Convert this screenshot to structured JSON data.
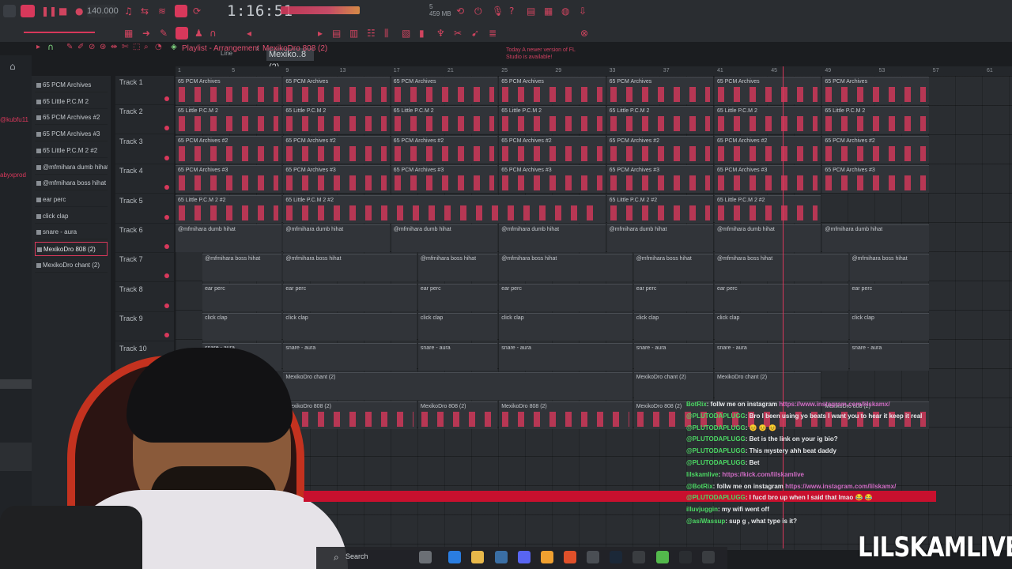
{
  "toolbar": {
    "tempo": "140.000",
    "song_time": "1:16:51",
    "memory": "459 MB",
    "cpu_line": "5",
    "line_mode": "Line",
    "mixer_track": "Mexiko..8 (2)",
    "update_notice": "Today  A newer version of FL Studio is available!",
    "accent_color": "#d8385b"
  },
  "breadcrumb": {
    "title": "Playlist - Arrangement",
    "separator": "›",
    "pattern": "MexikoDro 808 (2)"
  },
  "left_tags": [
    "@kubfu11",
    "abyxprod"
  ],
  "channel_picker": [
    {
      "label": "65 PCM Archives",
      "selected": false
    },
    {
      "label": "65 Little P.C.M 2",
      "selected": false
    },
    {
      "label": "65 PCM Archives #2",
      "selected": false
    },
    {
      "label": "65 PCM Archives #3",
      "selected": false
    },
    {
      "label": "65 Little P.C.M 2 #2",
      "selected": false
    },
    {
      "label": "@mfmihara dumb hihat",
      "selected": false
    },
    {
      "label": "@mfmihara boss hihat",
      "selected": false
    },
    {
      "label": "ear perc",
      "selected": false
    },
    {
      "label": "click clap",
      "selected": false
    },
    {
      "label": "snare - aura",
      "selected": false
    },
    {
      "label": "MexikoDro 808 (2)",
      "selected": true
    },
    {
      "label": "MexikoDro chant (2)",
      "selected": false
    }
  ],
  "tracks": [
    "Track 1",
    "Track 2",
    "Track 3",
    "Track 4",
    "Track 5",
    "Track 6",
    "Track 7",
    "Track 8",
    "Track 9",
    "Track 10"
  ],
  "ruler": [
    "1",
    "5",
    "9",
    "13",
    "17",
    "21",
    "25",
    "29",
    "33",
    "37",
    "41",
    "45",
    "49",
    "53",
    "57",
    "61"
  ],
  "clips": [
    {
      "row": 0,
      "name": "65 PCM Archives",
      "starts": [
        "1",
        "9",
        "17",
        "25",
        "33",
        "41",
        "49"
      ]
    },
    {
      "row": 1,
      "name": "65 Little P.C.M 2",
      "starts": [
        "1",
        "9",
        "17",
        "25",
        "33",
        "41",
        "49"
      ]
    },
    {
      "row": 2,
      "name": "65 PCM Archives #2",
      "starts": [
        "1",
        "9",
        "17",
        "25",
        "33",
        "41",
        "49"
      ]
    },
    {
      "row": 3,
      "name": "65 PCM Archives #3",
      "starts": [
        "1",
        "9",
        "17",
        "25",
        "33",
        "41",
        "49"
      ]
    },
    {
      "row": 4,
      "name": "65 Little P.C.M 2 #2",
      "starts": [
        "1",
        "9",
        "33",
        "41"
      ]
    },
    {
      "row": 5,
      "name": "@mfmihara dumb hihat",
      "starts": [
        "1",
        "9",
        "17",
        "25",
        "33",
        "41",
        "49"
      ]
    },
    {
      "row": 6,
      "name": "@mfmihara boss hihat",
      "starts": [
        "3",
        "9",
        "19",
        "25",
        "35",
        "41",
        "51"
      ]
    },
    {
      "row": 7,
      "name": "ear perc",
      "starts": [
        "3",
        "9",
        "19",
        "25",
        "35",
        "41",
        "51"
      ]
    },
    {
      "row": 8,
      "name": "click clap",
      "starts": [
        "3",
        "9",
        "19",
        "25",
        "35",
        "41",
        "51"
      ]
    },
    {
      "row": 9,
      "name": "snare - aura",
      "starts": [
        "3",
        "9",
        "19",
        "25",
        "35",
        "41",
        "51"
      ]
    },
    {
      "row": 10,
      "name": "MexikoDro chant (2)",
      "starts": [
        "9",
        "35",
        "41"
      ]
    },
    {
      "row": 11,
      "name": "MexikoDro 808 (2)",
      "starts": [
        "9",
        "19",
        "25",
        "35",
        "49"
      ]
    }
  ],
  "chat": [
    {
      "user": "BotRix",
      "text": ": follw me on instagram ",
      "link": "https://www.instagram.com/lilskamx/"
    },
    {
      "user": "@PLUTODAPLUGG",
      "text": ": Bro I been using yo beats I want you to hear it keep it real",
      "link": ""
    },
    {
      "user": "@PLUTODAPLUGG",
      "text": ": 😊 😊 😊",
      "link": ""
    },
    {
      "user": "@PLUTODAPLUGG",
      "text": ": Bet is the link on your ig bio?",
      "link": ""
    },
    {
      "user": "@PLUTODAPLUGG",
      "text": ": This mystery ahh beat daddy",
      "link": ""
    },
    {
      "user": "@PLUTODAPLUGG",
      "text": ": Bet",
      "link": ""
    },
    {
      "user": "lilskamlive",
      "text": ": ",
      "link": "https://kick.com/lilskamlive"
    },
    {
      "user": "@BotRix",
      "text": ": follw me on instagram ",
      "link": "https://www.instagram.com/lilskamx/"
    },
    {
      "user": "@PLUTODAPLUGG",
      "text": ": I fucd bro up when I said that lmao 😂 😂",
      "link": ""
    },
    {
      "user": "illuvjuggin",
      "text": ": my wifi went off",
      "link": ""
    },
    {
      "user": "@asiWassup",
      "text": ": sup g , what type is it?",
      "link": ""
    }
  ],
  "taskbar": {
    "search_label": "Search"
  },
  "watermark": "LILSKAMLIVE"
}
